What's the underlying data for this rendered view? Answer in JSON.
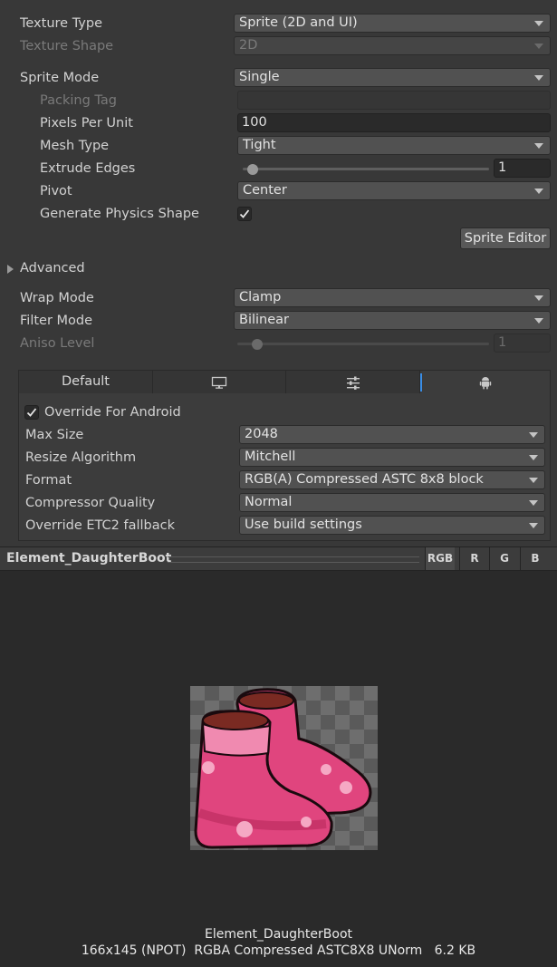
{
  "inspector": {
    "texture_type": {
      "label": "Texture Type",
      "value": "Sprite (2D and UI)"
    },
    "texture_shape": {
      "label": "Texture Shape",
      "value": "2D"
    },
    "sprite_mode": {
      "label": "Sprite Mode",
      "value": "Single"
    },
    "packing_tag": {
      "label": "Packing Tag",
      "value": ""
    },
    "pixels_per_unit": {
      "label": "Pixels Per Unit",
      "value": "100"
    },
    "mesh_type": {
      "label": "Mesh Type",
      "value": "Tight"
    },
    "extrude_edges": {
      "label": "Extrude Edges",
      "value": "1",
      "slider_fraction": 0.04
    },
    "pivot": {
      "label": "Pivot",
      "value": "Center"
    },
    "generate_physics_shape": {
      "label": "Generate Physics Shape",
      "checked": true
    },
    "sprite_editor_button": "Sprite Editor",
    "advanced": {
      "label": "Advanced",
      "expanded": false
    },
    "wrap_mode": {
      "label": "Wrap Mode",
      "value": "Clamp"
    },
    "filter_mode": {
      "label": "Filter Mode",
      "value": "Bilinear"
    },
    "aniso_level": {
      "label": "Aniso Level",
      "value": "1",
      "slider_fraction": 0.08
    }
  },
  "platform_tabs": [
    {
      "label": "Default",
      "icon": ""
    },
    {
      "label": "",
      "icon": "monitor-icon"
    },
    {
      "label": "",
      "icon": "sliders-icon"
    },
    {
      "label": "",
      "icon": "android-icon",
      "active": true
    }
  ],
  "platform_settings": {
    "override": {
      "label": "Override For Android",
      "checked": true
    },
    "max_size": {
      "label": "Max Size",
      "value": "2048"
    },
    "resize_algorithm": {
      "label": "Resize Algorithm",
      "value": "Mitchell"
    },
    "format": {
      "label": "Format",
      "value": "RGB(A) Compressed ASTC 8x8 block"
    },
    "compressor_quality": {
      "label": "Compressor Quality",
      "value": "Normal"
    },
    "override_etc2_fallback": {
      "label": "Override ETC2 fallback",
      "value": "Use build settings"
    }
  },
  "preview": {
    "title": "Element_DaughterBoot",
    "channels": [
      "RGB",
      "R",
      "G",
      "B"
    ],
    "active_channel": "RGB",
    "asset_name": "Element_DaughterBoot",
    "info": "166x145 (NPOT)  RGBA Compressed ASTC8X8 UNorm   6.2 KB"
  },
  "colors": {
    "boot_pink": "#e0457e",
    "boot_dark_pink": "#b82a5c",
    "boot_light": "#f08ab0",
    "boot_opening": "#7a2a22",
    "flower": "#f5a8c4",
    "accent_blue": "#3a8ee6"
  }
}
